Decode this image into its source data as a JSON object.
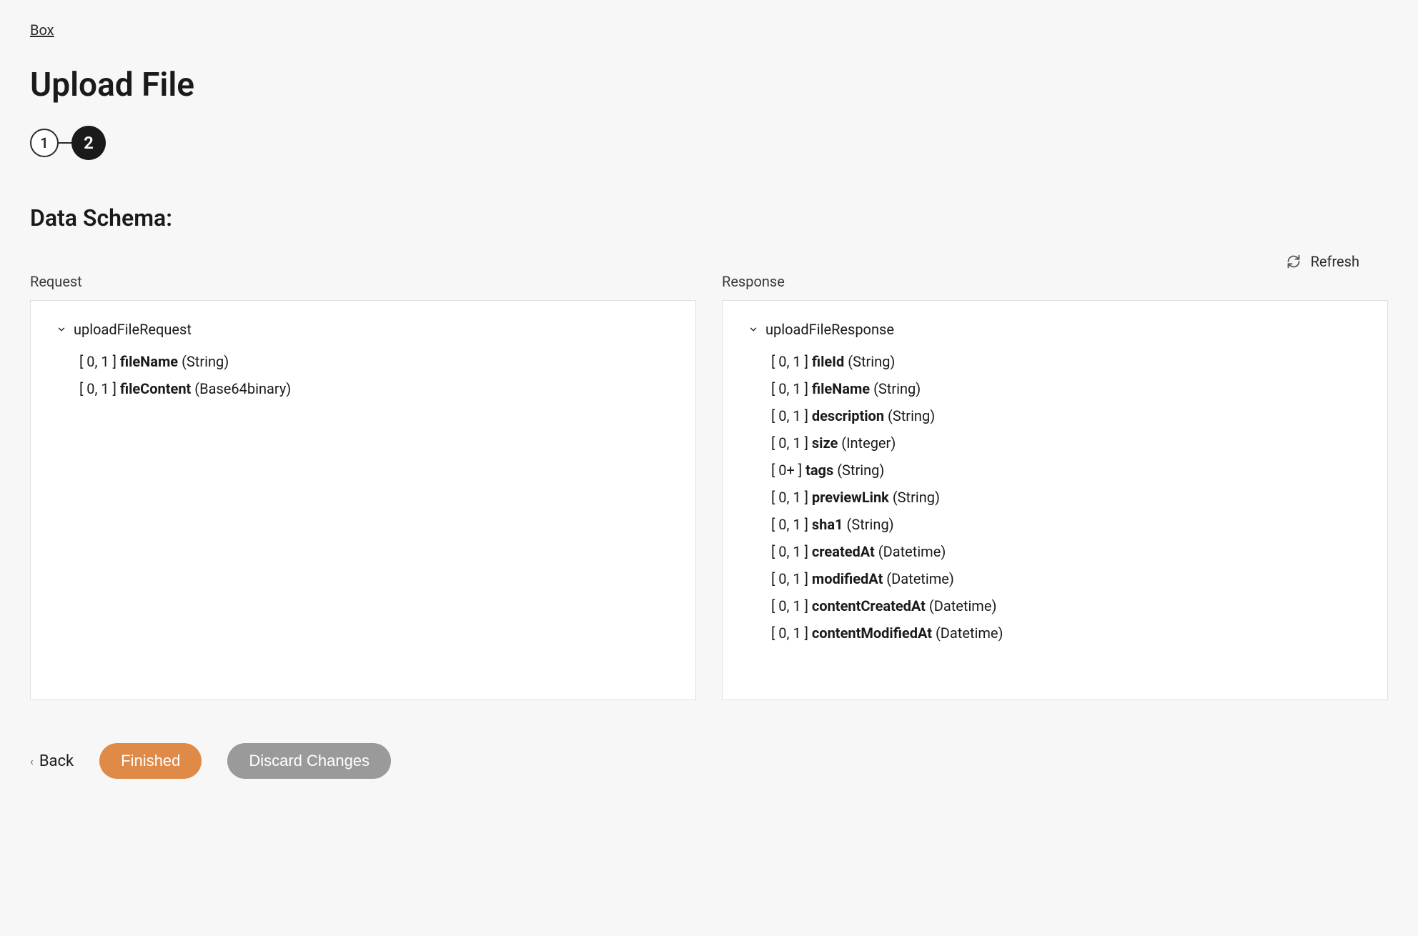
{
  "breadcrumb": {
    "label": "Box"
  },
  "page": {
    "title": "Upload File"
  },
  "stepper": {
    "step1": "1",
    "step2": "2"
  },
  "section": {
    "title": "Data Schema:"
  },
  "refresh": {
    "label": "Refresh"
  },
  "request": {
    "label": "Request",
    "root": "uploadFileRequest",
    "fields": [
      {
        "card": "[ 0, 1 ]",
        "name": "fileName",
        "type": "(String)"
      },
      {
        "card": "[ 0, 1 ]",
        "name": "fileContent",
        "type": "(Base64binary)"
      }
    ]
  },
  "response": {
    "label": "Response",
    "root": "uploadFileResponse",
    "fields": [
      {
        "card": "[ 0, 1 ]",
        "name": "fileId",
        "type": "(String)"
      },
      {
        "card": "[ 0, 1 ]",
        "name": "fileName",
        "type": "(String)"
      },
      {
        "card": "[ 0, 1 ]",
        "name": "description",
        "type": "(String)"
      },
      {
        "card": "[ 0, 1 ]",
        "name": "size",
        "type": "(Integer)"
      },
      {
        "card": "[ 0+ ]",
        "name": "tags",
        "type": "(String)"
      },
      {
        "card": "[ 0, 1 ]",
        "name": "previewLink",
        "type": "(String)"
      },
      {
        "card": "[ 0, 1 ]",
        "name": "sha1",
        "type": "(String)"
      },
      {
        "card": "[ 0, 1 ]",
        "name": "createdAt",
        "type": "(Datetime)"
      },
      {
        "card": "[ 0, 1 ]",
        "name": "modifiedAt",
        "type": "(Datetime)"
      },
      {
        "card": "[ 0, 1 ]",
        "name": "contentCreatedAt",
        "type": "(Datetime)"
      },
      {
        "card": "[ 0, 1 ]",
        "name": "contentModifiedAt",
        "type": "(Datetime)"
      }
    ]
  },
  "actions": {
    "back": "Back",
    "finished": "Finished",
    "discard": "Discard Changes"
  }
}
